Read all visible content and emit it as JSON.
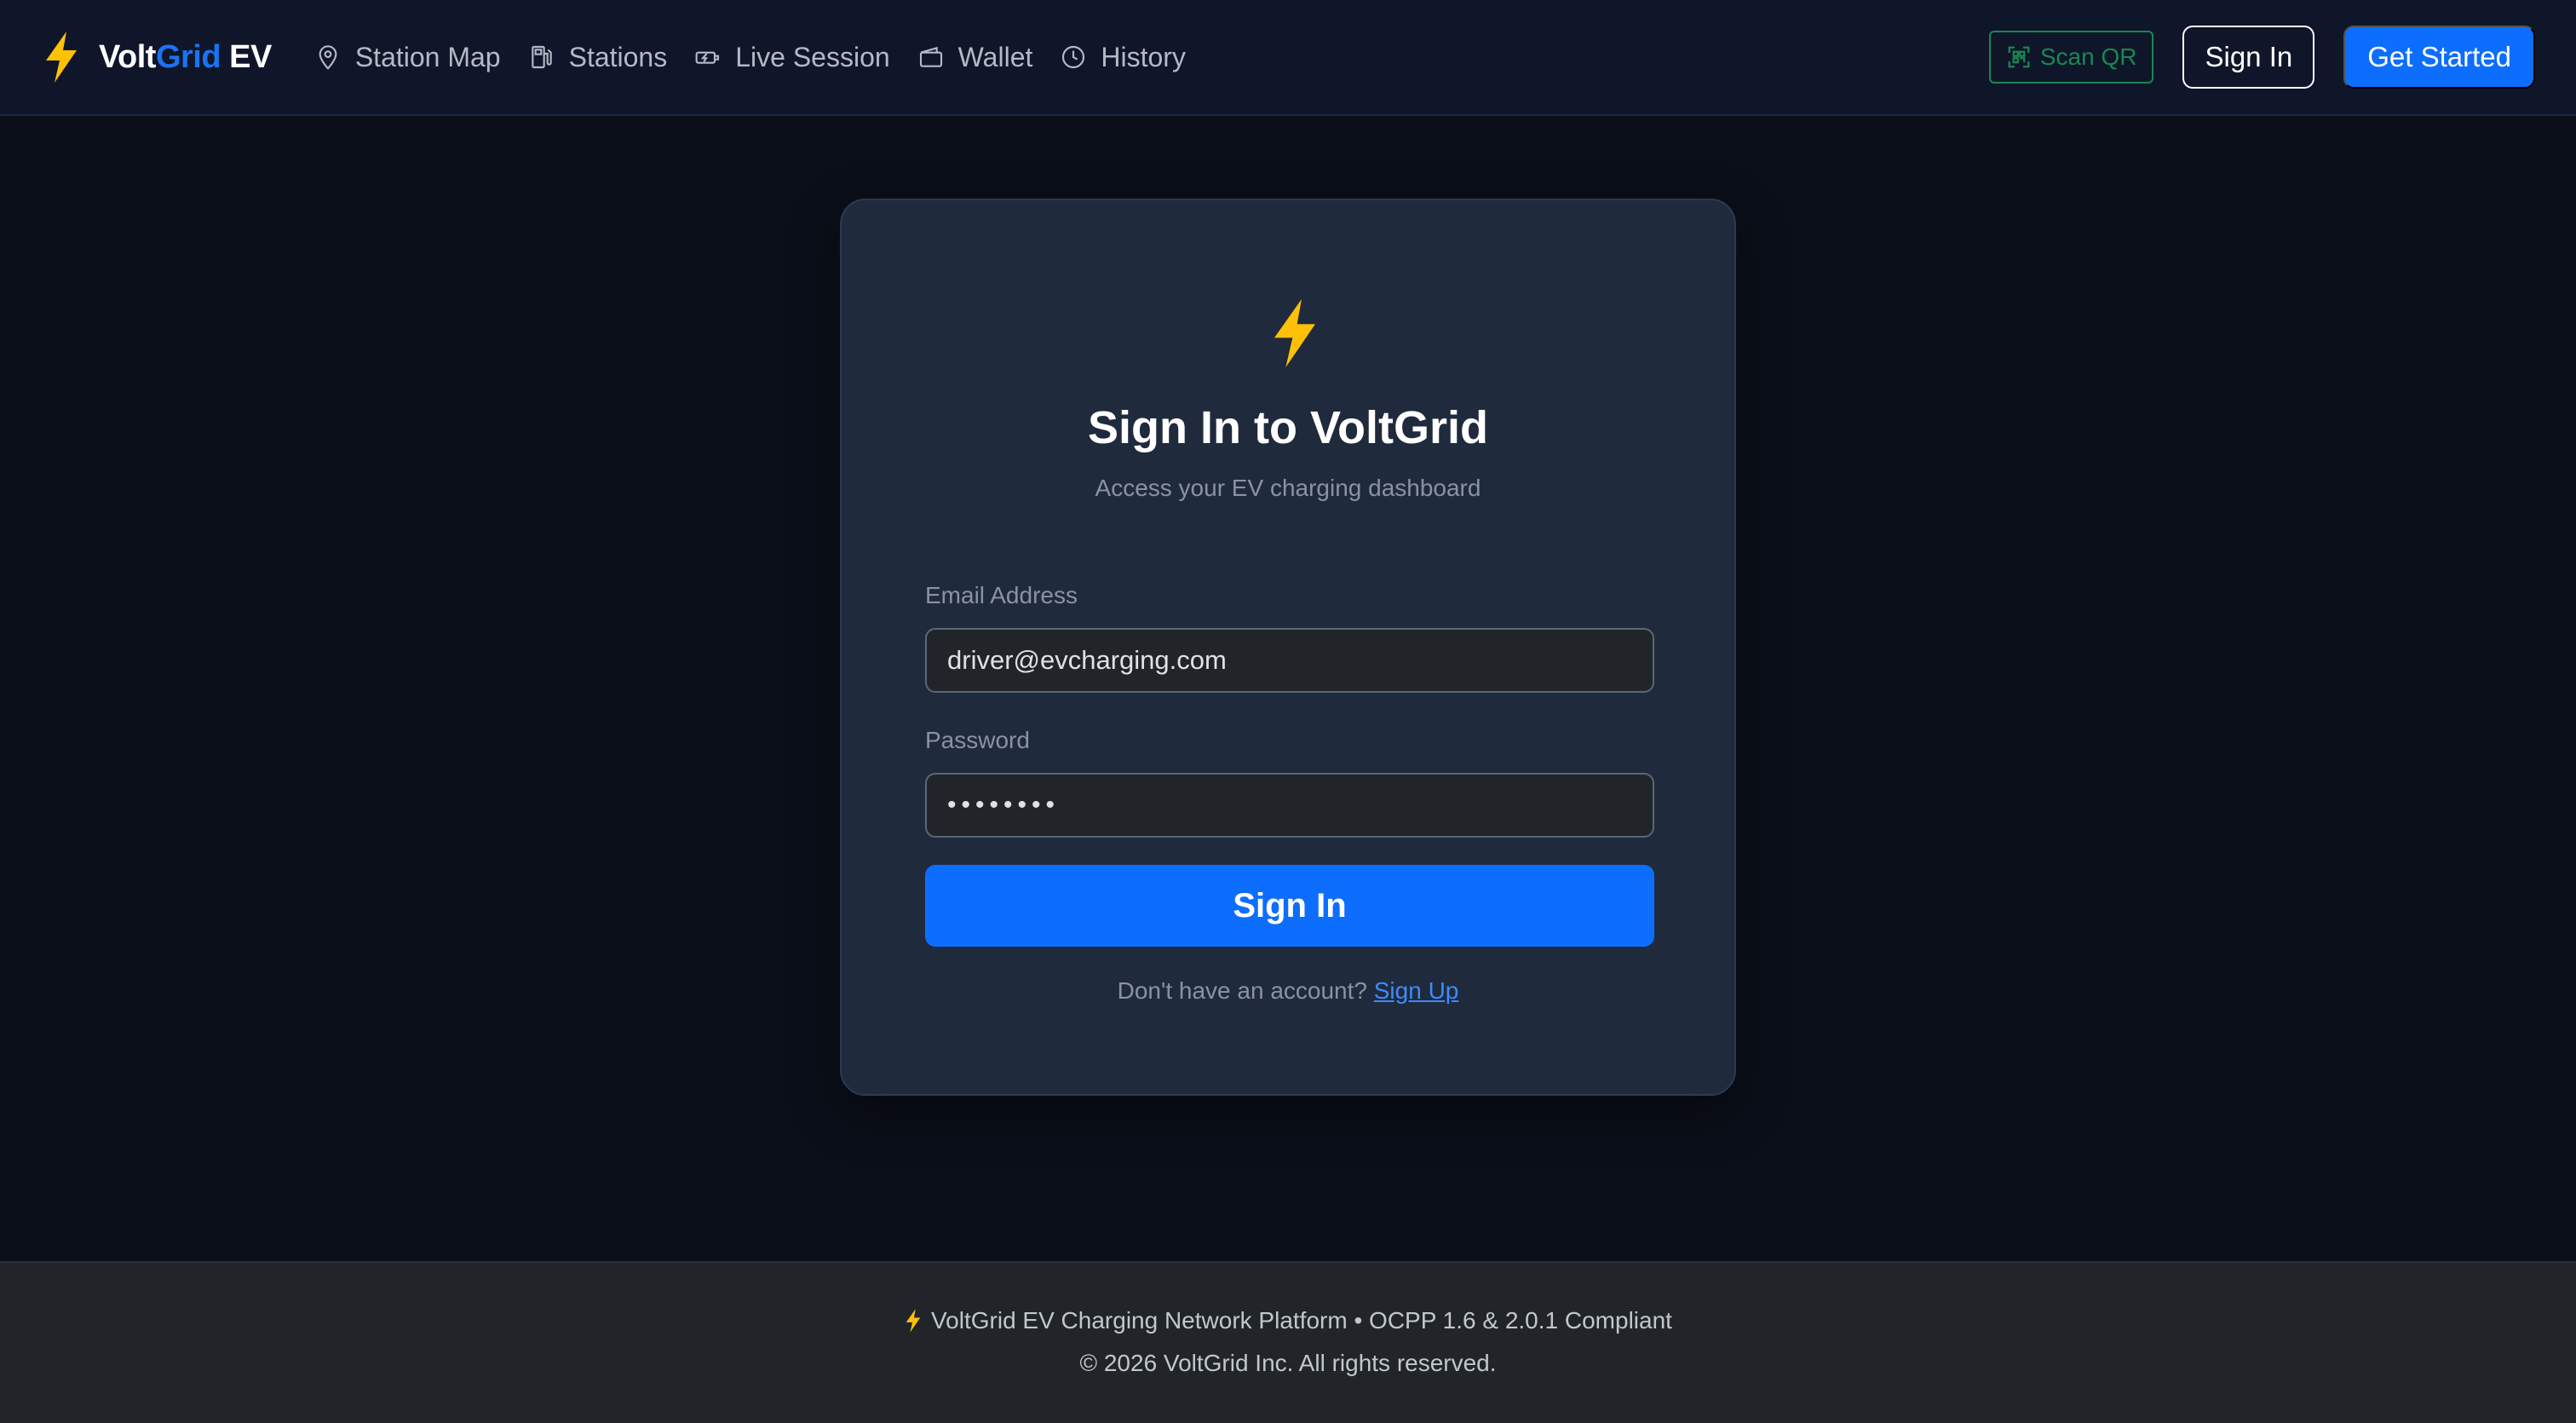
{
  "colors": {
    "accent": "#0d6efd",
    "bolt": "#ffc107",
    "scan_green": "#198754",
    "background": "#0b0f19",
    "card": "#1f2a3c"
  },
  "navbar": {
    "brand": {
      "volt": "Volt",
      "grid": "Grid",
      "ev": " EV",
      "icon": "lightning-bolt-icon"
    },
    "links": [
      {
        "label": "Station Map",
        "icon": "map-pin-icon"
      },
      {
        "label": "Stations",
        "icon": "fuel-pump-icon"
      },
      {
        "label": "Live Session",
        "icon": "ev-plug-icon"
      },
      {
        "label": "Wallet",
        "icon": "wallet-icon"
      },
      {
        "label": "History",
        "icon": "clock-icon"
      }
    ],
    "scan_qr": {
      "label": "Scan QR",
      "icon": "qr-code-icon"
    },
    "sign_in": "Sign In",
    "get_started": "Get Started"
  },
  "login": {
    "icon": "lightning-bolt-icon",
    "title": "Sign In to VoltGrid",
    "subtitle": "Access your EV charging dashboard",
    "email_label": "Email Address",
    "email_value": "driver@evcharging.com",
    "password_label": "Password",
    "password_value": "••••••••",
    "submit": "Sign In",
    "signup_prompt": "Don't have an account?",
    "signup_link": "Sign Up"
  },
  "footer": {
    "line1": "VoltGrid EV Charging Network Platform • OCPP 1.6 & 2.0.1 Compliant",
    "line2": "© 2026 VoltGrid Inc. All rights reserved."
  }
}
